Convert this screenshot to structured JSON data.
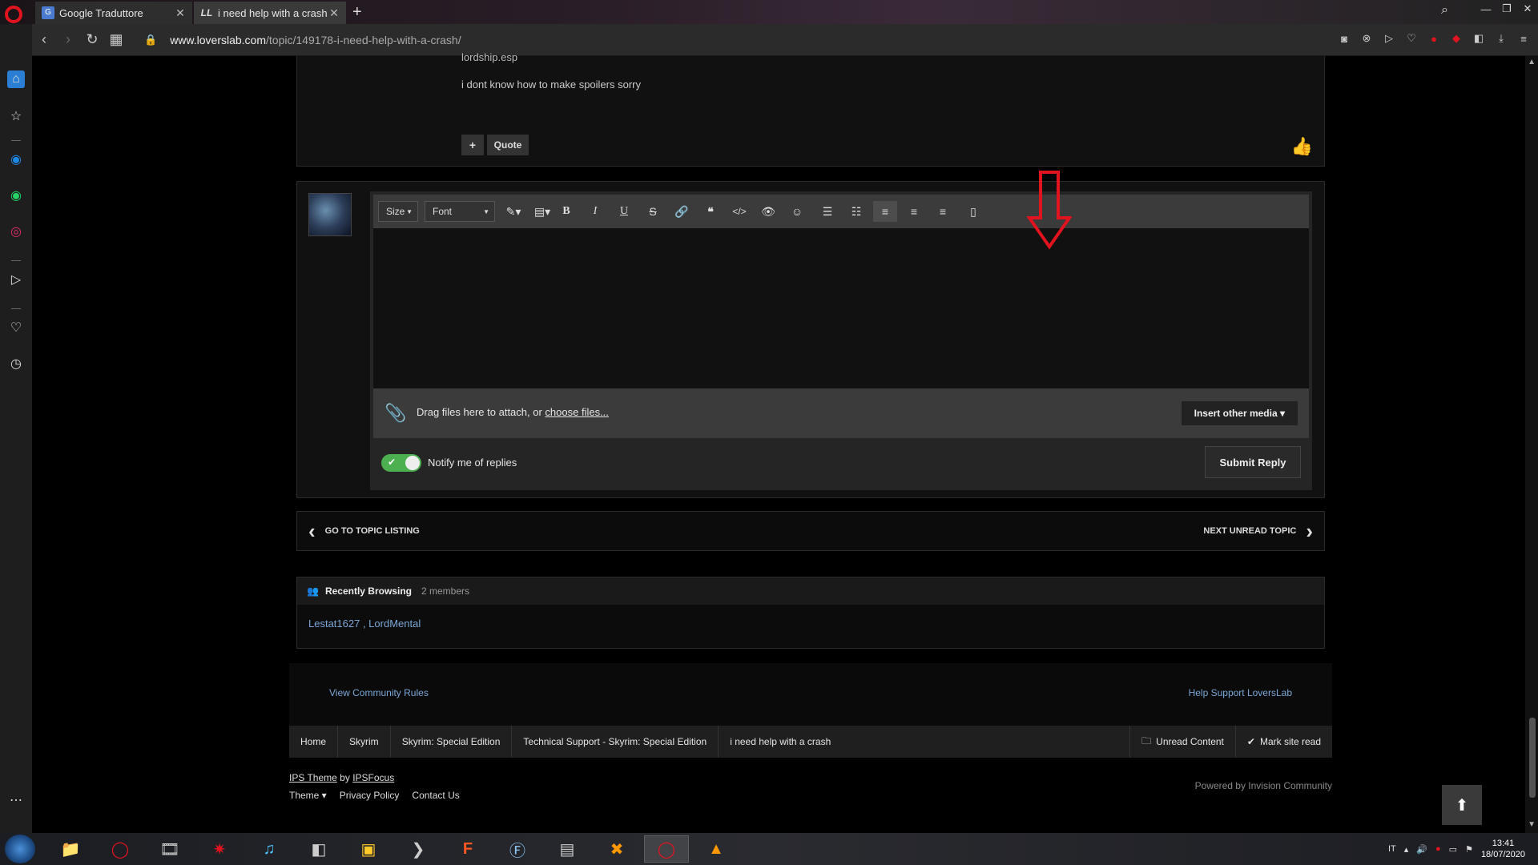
{
  "browser": {
    "tabs": [
      {
        "title": "Google Traduttore",
        "favicon": "G"
      },
      {
        "title": "i need help with a crash - T",
        "favicon": "LL"
      }
    ],
    "url_domain": "www.loverslab.com",
    "url_path": "/topic/149178-i-need-help-with-a-crash/"
  },
  "post": {
    "cut_text": "lordship.esp",
    "message": "i dont know how to make spoilers sorry",
    "quote_label": "Quote",
    "plus_label": "+"
  },
  "editor": {
    "size_label": "Size",
    "font_label": "Font",
    "attach_text": "Drag files here to attach, or ",
    "choose_files": "choose files...",
    "insert_media": "Insert other media ▾",
    "notify_label": "Notify me of replies",
    "submit_label": "Submit Reply"
  },
  "topic_nav": {
    "prev_label": "GO TO TOPIC LISTING",
    "next_label": "NEXT UNREAD TOPIC"
  },
  "recently_browsing": {
    "title": "Recently Browsing",
    "count": "2 members",
    "users": "Lestat1627 , LordMental"
  },
  "footer": {
    "community_rules": "View Community Rules",
    "help_support": "Help Support LoversLab",
    "breadcrumbs": [
      "Home",
      "Skyrim",
      "Skyrim: Special Edition",
      "Technical Support - Skyrim: Special Edition",
      "i need help with a crash"
    ],
    "unread_content": "Unread Content",
    "mark_site_read": "Mark site read",
    "ips_theme": "IPS Theme",
    "by": "by",
    "ipsfocus": "IPSFocus",
    "theme": "Theme ▾",
    "privacy": "Privacy Policy",
    "contact": "Contact Us",
    "powered": "Powered by Invision Community"
  },
  "taskbar": {
    "lang": "IT",
    "time": "13:41",
    "date": "18/07/2020"
  },
  "colors": {
    "accent_link": "#7aa7d6",
    "toggle_on": "#4caf50",
    "annotation_arrow": "#e0131f"
  }
}
